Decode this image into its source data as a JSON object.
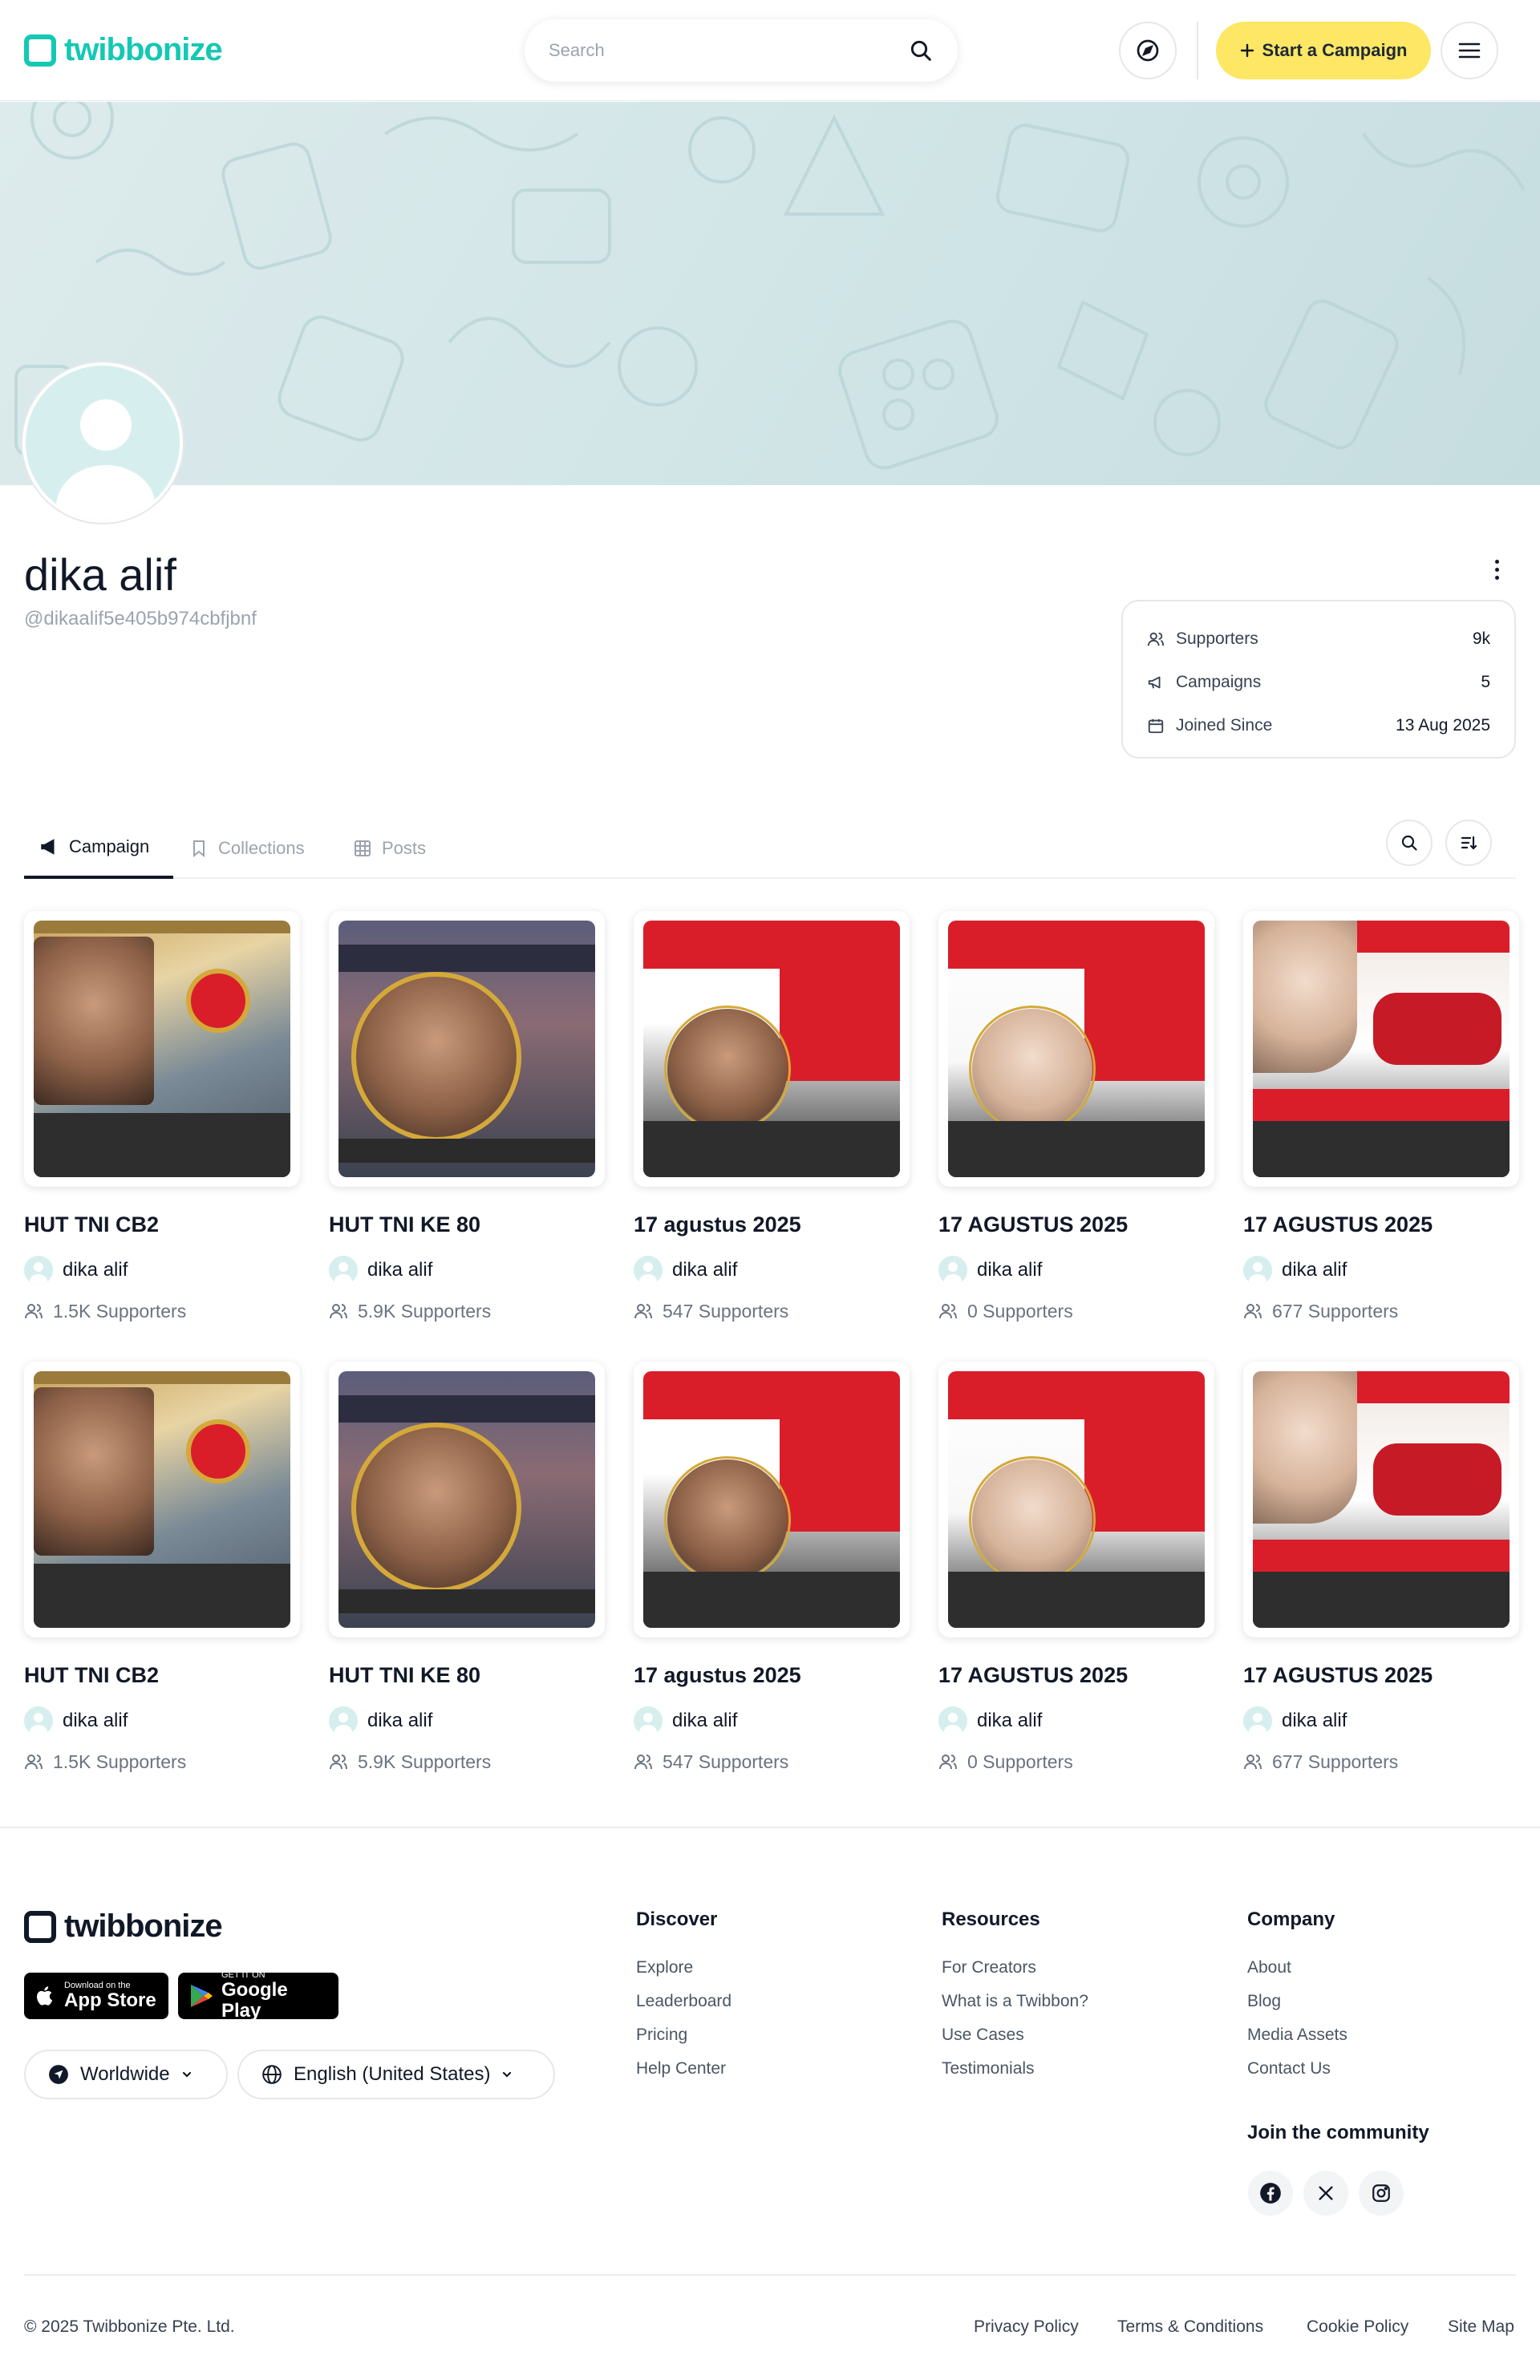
{
  "header": {
    "logo_text": "twibbonize",
    "search_placeholder": "Search",
    "start_campaign_label": "Start a Campaign",
    "icons": [
      "search-icon",
      "compass-icon",
      "plus-icon",
      "hamburger-menu-icon"
    ],
    "accent_color": "#14c8b4",
    "cta_color": "#fde764"
  },
  "profile": {
    "name": "dika alif",
    "handle": "@dikaalif5e405b974cbfjbnf",
    "stats": [
      {
        "label": "Supporters",
        "value": "9k",
        "icon": "users-icon"
      },
      {
        "label": "Campaigns",
        "value": "5",
        "icon": "megaphone-icon"
      },
      {
        "label": "Joined Since",
        "value": "13 Aug 2025",
        "icon": "calendar-icon"
      }
    ]
  },
  "tabs": [
    {
      "label": "Campaign",
      "icon": "megaphone-icon",
      "active": true
    },
    {
      "label": "Collections",
      "icon": "bookmark-icon",
      "active": false
    },
    {
      "label": "Posts",
      "icon": "grid-icon",
      "active": false
    }
  ],
  "campaigns": [
    {
      "title": "HUT TNI CB2",
      "creator": "dika alif",
      "supporters": "1.5K Supporters"
    },
    {
      "title": "HUT TNI KE 80",
      "creator": "dika alif",
      "supporters": "5.9K Supporters"
    },
    {
      "title": "17 agustus 2025",
      "creator": "dika alif",
      "supporters": "547 Supporters"
    },
    {
      "title": "17 AGUSTUS 2025",
      "creator": "dika alif",
      "supporters": "0 Supporters"
    },
    {
      "title": "17 AGUSTUS 2025",
      "creator": "dika alif",
      "supporters": "677 Supporters"
    },
    {
      "title": "HUT TNI CB2",
      "creator": "dika alif",
      "supporters": "1.5K Supporters"
    },
    {
      "title": "HUT TNI KE 80",
      "creator": "dika alif",
      "supporters": "5.9K Supporters"
    },
    {
      "title": "17 agustus 2025",
      "creator": "dika alif",
      "supporters": "547 Supporters"
    },
    {
      "title": "17 AGUSTUS 2025",
      "creator": "dika alif",
      "supporters": "0 Supporters"
    },
    {
      "title": "17 AGUSTUS 2025",
      "creator": "dika alif",
      "supporters": "677 Supporters"
    }
  ],
  "footer": {
    "logo_text": "twibbonize",
    "app_store": {
      "small": "Download on the",
      "big": "App Store"
    },
    "google_play": {
      "small": "GET IT ON",
      "big": "Google Play"
    },
    "region": "Worldwide",
    "language": "English (United States)",
    "discover": {
      "title": "Discover",
      "links": [
        "Explore",
        "Leaderboard",
        "Pricing",
        "Help Center"
      ]
    },
    "resources": {
      "title": "Resources",
      "links": [
        "For Creators",
        "What is a Twibbon?",
        "Use Cases",
        "Testimonials"
      ]
    },
    "company": {
      "title": "Company",
      "links": [
        "About",
        "Blog",
        "Media Assets",
        "Contact Us"
      ]
    },
    "community_title": "Join the community",
    "social_icons": [
      "facebook-icon",
      "x-icon",
      "instagram-icon"
    ],
    "copyright": "© 2025 Twibbonize Pte. Ltd.",
    "legal": [
      "Privacy Policy",
      "Terms & Conditions",
      "Cookie Policy",
      "Site Map"
    ]
  }
}
